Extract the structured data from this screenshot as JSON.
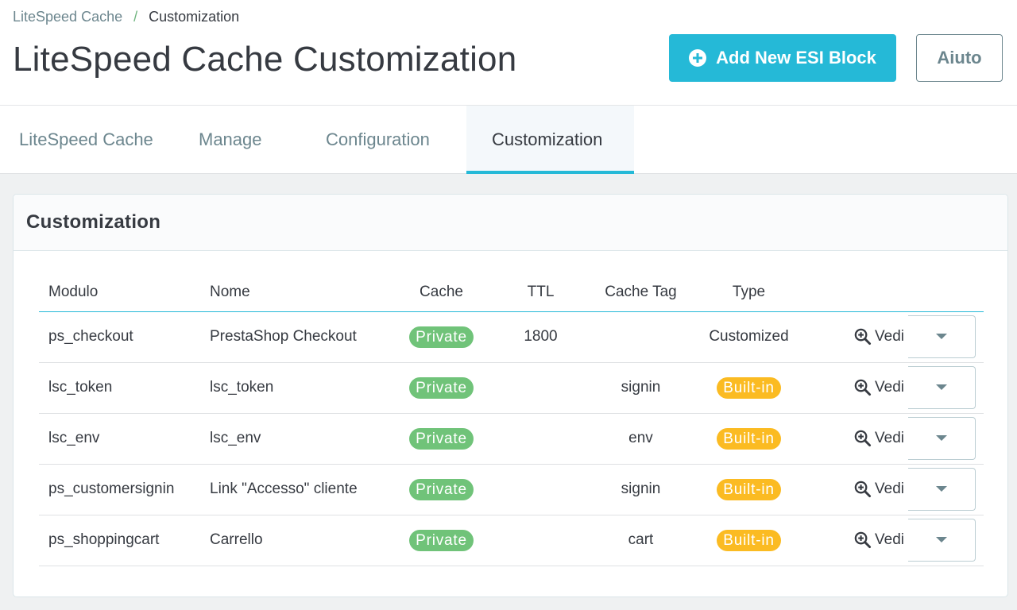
{
  "breadcrumb": {
    "parent": "LiteSpeed Cache",
    "separator": "/",
    "current": "Customization"
  },
  "page_title": "LiteSpeed Cache Customization",
  "toolbar": {
    "add_label": "Add New ESI Block",
    "help_label": "Aiuto"
  },
  "tabs": [
    {
      "label": "LiteSpeed Cache",
      "active": false
    },
    {
      "label": "Manage",
      "active": false
    },
    {
      "label": "Configuration",
      "active": false
    },
    {
      "label": "Customization",
      "active": true
    }
  ],
  "card": {
    "title": "Customization"
  },
  "table": {
    "columns": [
      "Modulo",
      "Nome",
      "Cache",
      "TTL",
      "Cache Tag",
      "Type"
    ],
    "action_label": "Vedi",
    "rows": [
      {
        "modulo": "ps_checkout",
        "nome": "PrestaShop Checkout",
        "cache": "Private",
        "ttl": "1800",
        "tag": "",
        "type": "Customized",
        "type_badge": false
      },
      {
        "modulo": "lsc_token",
        "nome": "lsc_token",
        "cache": "Private",
        "ttl": "",
        "tag": "signin",
        "type": "Built-in",
        "type_badge": true
      },
      {
        "modulo": "lsc_env",
        "nome": "lsc_env",
        "cache": "Private",
        "ttl": "",
        "tag": "env",
        "type": "Built-in",
        "type_badge": true
      },
      {
        "modulo": "ps_customersignin",
        "nome": "Link \"Accesso\" cliente",
        "cache": "Private",
        "ttl": "",
        "tag": "signin",
        "type": "Built-in",
        "type_badge": true
      },
      {
        "modulo": "ps_shoppingcart",
        "nome": "Carrello",
        "cache": "Private",
        "ttl": "",
        "tag": "cart",
        "type": "Built-in",
        "type_badge": true
      }
    ]
  },
  "colors": {
    "accent": "#25b9d7",
    "private_badge": "#70c379",
    "builtin_badge": "#fbbb22",
    "text": "#363a41",
    "muted": "#6c868e"
  },
  "icons": {
    "add": "plus-circle-icon",
    "view": "zoom-in-icon",
    "dropdown": "caret-down-icon"
  }
}
